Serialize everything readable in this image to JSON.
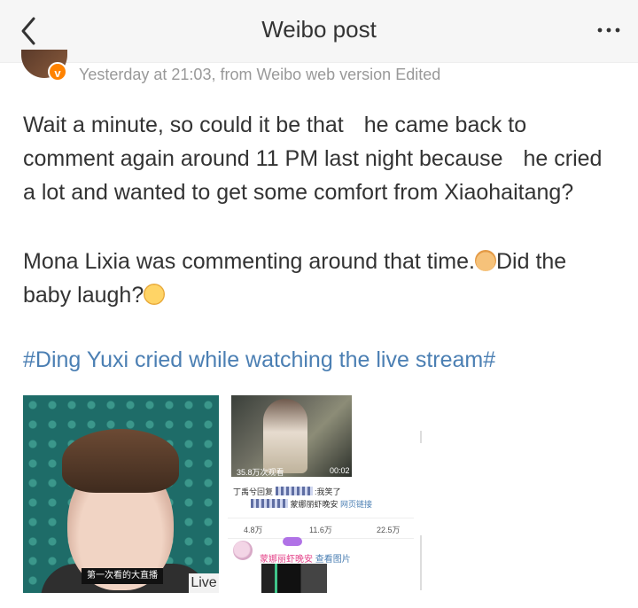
{
  "header": {
    "title": "Weibo post"
  },
  "post": {
    "meta": "Yesterday at 21:03, from Weibo web version Edited",
    "verified_badge": "v",
    "paragraph1": [
      "Wait a minute, so could it be that ",
      "he came back to comment again around 11 PM last night because ",
      "he cried a lot and wanted to get some comfort from Xiaohaitang?"
    ],
    "paragraph2": [
      "Mona Lixia was commenting around that time.",
      "Did the baby laugh?"
    ],
    "hashtag": "#Ding Yuxi cried while watching the live stream#"
  },
  "images": {
    "image1": {
      "subtitle": "第一次看的大直播",
      "badge": "Live"
    },
    "image2": {
      "views": "35.8万次观看",
      "duration": "00:02",
      "comment_prefix": "丁禹兮回复",
      "comment_suffix": ":我笑了",
      "comment2_author": "蒙娜丽虾晚安",
      "comment2_link": "网页链接",
      "stats": [
        "4.8万",
        "11.6万",
        "22.5万"
      ],
      "reply_author": "蒙娜丽虾晚安",
      "reply_link": "查看图片"
    }
  },
  "colors": {
    "link": "#4b7fb3",
    "meta": "#999999",
    "text": "#333333",
    "badge": "#ff8200"
  },
  "icons": [
    "chevron-left-icon",
    "more-icon",
    "dog-emoji-icon",
    "crying-emoji-icon"
  ]
}
